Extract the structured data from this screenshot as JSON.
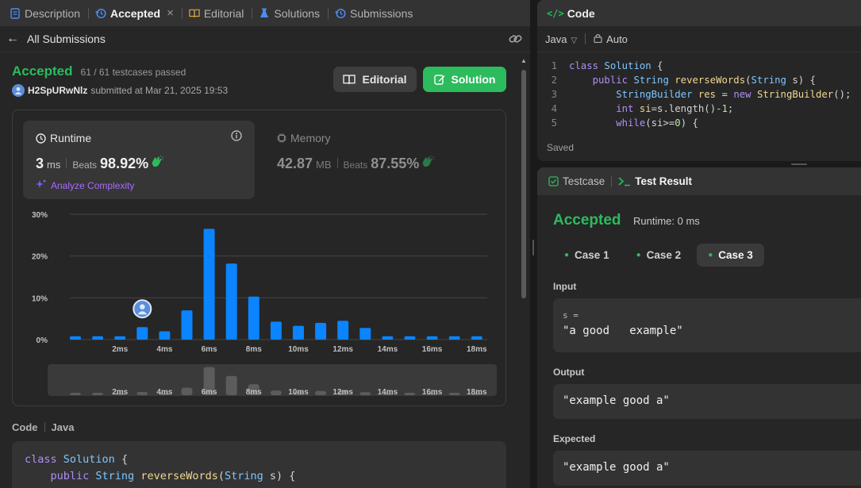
{
  "left_tabs": [
    {
      "label": "Description",
      "active": false
    },
    {
      "label": "Accepted",
      "active": true
    },
    {
      "label": "Editorial",
      "active": false
    },
    {
      "label": "Solutions",
      "active": false
    },
    {
      "label": "Submissions",
      "active": false
    }
  ],
  "back_label": "All Submissions",
  "result": {
    "status": "Accepted",
    "testcases": "61 / 61 testcases passed",
    "username": "H2SpURwNlz",
    "submitted_text": "submitted at Mar 21, 2025 19:53"
  },
  "buttons": {
    "editorial": "Editorial",
    "solution": "Solution"
  },
  "runtime": {
    "title": "Runtime",
    "value": "3",
    "unit": "ms",
    "beats_label": "Beats",
    "beats_pct": "98.92%",
    "analyze": "Analyze Complexity"
  },
  "memory": {
    "title": "Memory",
    "value": "42.87",
    "unit": "MB",
    "beats_label": "Beats",
    "beats_pct": "87.55%"
  },
  "chart_data": {
    "type": "bar",
    "y_ticks": [
      "30%",
      "20%",
      "10%",
      "0%"
    ],
    "ylim": [
      0,
      30
    ],
    "x_tick_labels": [
      "2ms",
      "4ms",
      "6ms",
      "8ms",
      "10ms",
      "12ms",
      "14ms",
      "16ms",
      "18ms"
    ],
    "values": [
      0.8,
      0.8,
      0.8,
      3.0,
      2.0,
      7.0,
      26.5,
      18.2,
      10.3,
      4.3,
      3.3,
      4.0,
      4.5,
      2.8,
      0.8,
      0.8,
      0.8,
      0.8,
      0.8
    ],
    "user_bar_index": 3,
    "bar_color": "#0a84ff"
  },
  "code_label": "Code",
  "code_lang": "Java",
  "code_preview": [
    [
      {
        "t": "class ",
        "c": "#b18ef5"
      },
      {
        "t": "Solution",
        "c": "#7ec6ff"
      },
      {
        "t": " {",
        "c": "#d4d4d4"
      }
    ],
    [
      {
        "t": "    public ",
        "c": "#b18ef5"
      },
      {
        "t": "String ",
        "c": "#7ec6ff"
      },
      {
        "t": "reverseWords",
        "c": "#f0d890"
      },
      {
        "t": "(",
        "c": "#d4d4d4"
      },
      {
        "t": "String",
        "c": "#7ec6ff"
      },
      {
        "t": " s) {",
        "c": "#d4d4d4"
      }
    ],
    [
      {
        "t": "        StringBuilder res = new StringBuilder();",
        "c": "#7ec6ff"
      }
    ]
  ],
  "code_panel": {
    "title": "Code",
    "language": "Java",
    "mode": "Auto",
    "saved": "Saved",
    "lines": [
      {
        "n": "1",
        "tokens": [
          {
            "t": "class ",
            "c": "#b18ef5"
          },
          {
            "t": "Solution",
            "c": "#7ec6ff"
          },
          {
            "t": " {",
            "c": "#d4d4d4"
          }
        ]
      },
      {
        "n": "2",
        "tokens": [
          {
            "t": "    public ",
            "c": "#b18ef5"
          },
          {
            "t": "String ",
            "c": "#7ec6ff"
          },
          {
            "t": "reverseWords",
            "c": "#f0d890"
          },
          {
            "t": "(",
            "c": "#d4d4d4"
          },
          {
            "t": "String",
            "c": "#7ec6ff"
          },
          {
            "t": " s) {",
            "c": "#d4d4d4"
          }
        ]
      },
      {
        "n": "3",
        "tokens": [
          {
            "t": "        StringBuilder ",
            "c": "#7ec6ff"
          },
          {
            "t": "res",
            "c": "#f0d890"
          },
          {
            "t": " = ",
            "c": "#d4d4d4"
          },
          {
            "t": "new ",
            "c": "#b18ef5"
          },
          {
            "t": "StringBuilder",
            "c": "#f0d890"
          },
          {
            "t": "();",
            "c": "#d4d4d4"
          }
        ]
      },
      {
        "n": "4",
        "tokens": [
          {
            "t": "        int ",
            "c": "#b18ef5"
          },
          {
            "t": "si",
            "c": "#f0d890"
          },
          {
            "t": "=s.length()-",
            "c": "#d4d4d4"
          },
          {
            "t": "1",
            "c": "#b5e8a0"
          },
          {
            "t": ";",
            "c": "#d4d4d4"
          }
        ]
      },
      {
        "n": "5",
        "tokens": [
          {
            "t": "        while",
            "c": "#b18ef5"
          },
          {
            "t": "(si>=",
            "c": "#d4d4d4"
          },
          {
            "t": "0",
            "c": "#b5e8a0"
          },
          {
            "t": ") {",
            "c": "#d4d4d4"
          }
        ]
      }
    ]
  },
  "test_panel": {
    "tab_testcase": "Testcase",
    "tab_result": "Test Result",
    "status": "Accepted",
    "runtime": "Runtime: 0 ms",
    "cases": [
      "Case 1",
      "Case 2",
      "Case 3"
    ],
    "active_case_index": 2,
    "input_label": "Input",
    "input_var": "s =",
    "input_value": "\"a good   example\"",
    "output_label": "Output",
    "output_value": "\"example good a\"",
    "expected_label": "Expected",
    "expected_value": "\"example good a\""
  }
}
